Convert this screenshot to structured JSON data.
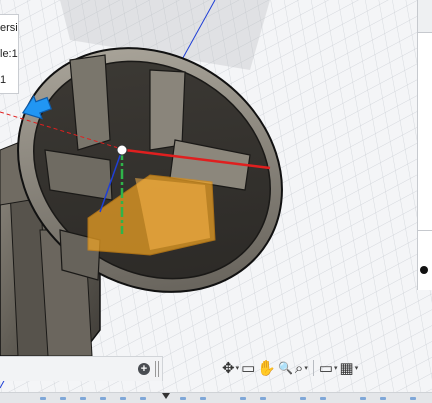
{
  "left_panel": {
    "item_1": "ersis",
    "item_2": "le:1",
    "item_3": "1"
  },
  "browser_bar": {
    "add_label": "+"
  },
  "toolbar": {
    "move_icon": "✥",
    "capture_icon": "▭",
    "pan_icon": "✋",
    "zoom_icon": "🔍",
    "fit_icon": "⌕",
    "display_icon": "▭",
    "grid_icon": "▦",
    "caret": "▾"
  },
  "colors": {
    "body_fill": "#5b5750",
    "selection_orange": "#f5a623",
    "axis_red": "#e01f1f",
    "axis_green": "#2fb44a",
    "axis_blue": "#1f3fd6",
    "arrow_blue": "#2196f3"
  }
}
